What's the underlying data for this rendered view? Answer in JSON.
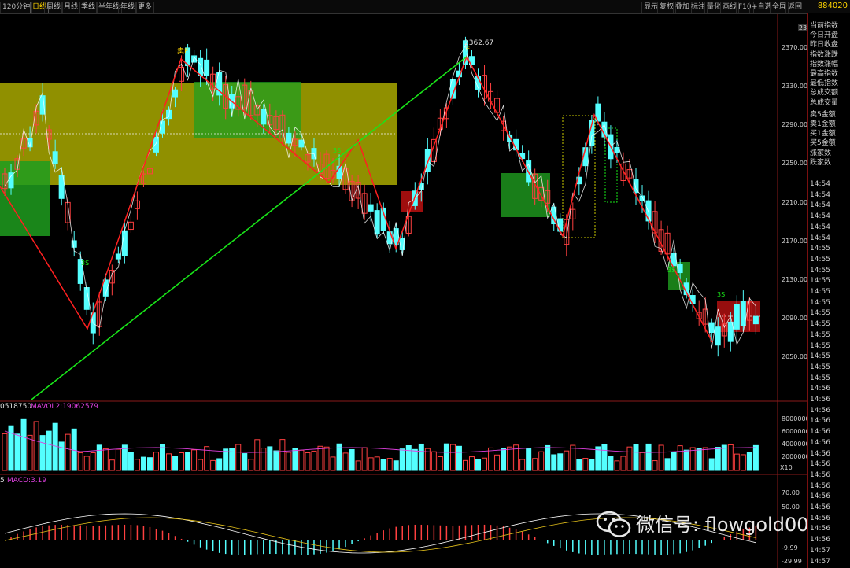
{
  "toolbar": {
    "left_tabs": [
      "120分钟",
      "日线",
      "周线",
      "月线",
      "季线",
      "半年线",
      "年线",
      "更多"
    ],
    "active_tab": "日线",
    "right_buttons": [
      "显示",
      "复权",
      "叠加",
      "标注",
      "量化",
      "画线",
      "F10",
      "+自选",
      "全屏",
      "返回"
    ],
    "code": "884020"
  },
  "price_axis": {
    "current_value": "2386.48",
    "ticks": [
      "2370.00",
      "2330.00",
      "2290.00",
      "2250.00",
      "2210.00",
      "2170.00",
      "2130.00",
      "2090.00",
      "2050.00"
    ]
  },
  "annotations": {
    "high_label": "2362.67",
    "left_high_mark": "卖F",
    "right_high_mark": "F",
    "green_marks": [
      "3S",
      "3S",
      "3S",
      "3S"
    ]
  },
  "volume": {
    "label_vol": "0518750",
    "label_mavol": "MAVOL2:19062579",
    "ticks": [
      "8000000",
      "6000000",
      "4000000",
      "2000000"
    ],
    "scale_unit": "X10"
  },
  "macd": {
    "label_left": "5",
    "label_macd": "MACD:3.19",
    "ticks": [
      "70.00",
      "50.00",
      "-9.99",
      "-29.99"
    ]
  },
  "side_panel": {
    "items": [
      "当前指数",
      "今日开盘",
      "昨日收盘",
      "指数涨跌",
      "指数涨幅",
      "最高指数",
      "最低指数",
      "总成交额",
      "总成交量",
      "卖5金额",
      "卖1金额",
      "买1金额",
      "买5金额",
      "涨家数",
      "跌家数"
    ],
    "times": [
      "14:54",
      "14:54",
      "14:54",
      "14:54",
      "14:54",
      "14:54",
      "14:55",
      "14:55",
      "14:55",
      "14:55",
      "14:55",
      "14:55",
      "14:55",
      "14:55",
      "14:55",
      "14:55",
      "14:55",
      "14:55",
      "14:55",
      "14:56",
      "14:56",
      "14:56",
      "14:56",
      "14:56",
      "14:56",
      "14:56",
      "14:56",
      "14:56",
      "14:56",
      "14:56",
      "14:56",
      "14:56",
      "14:56",
      "14:56",
      "14:57",
      "14:57"
    ]
  },
  "watermark": "微信号: flowgold00",
  "colors": {
    "up": "#ff4040",
    "down": "#54ffff",
    "zs_zone": "#c8c800",
    "green_zone": "#1f9d1f",
    "red_zone": "#b01010",
    "bi_line": "#ff2020",
    "segment_line": "#19e619",
    "macd_dif": "#ffffff",
    "macd_dea": "#e6c21a"
  }
}
